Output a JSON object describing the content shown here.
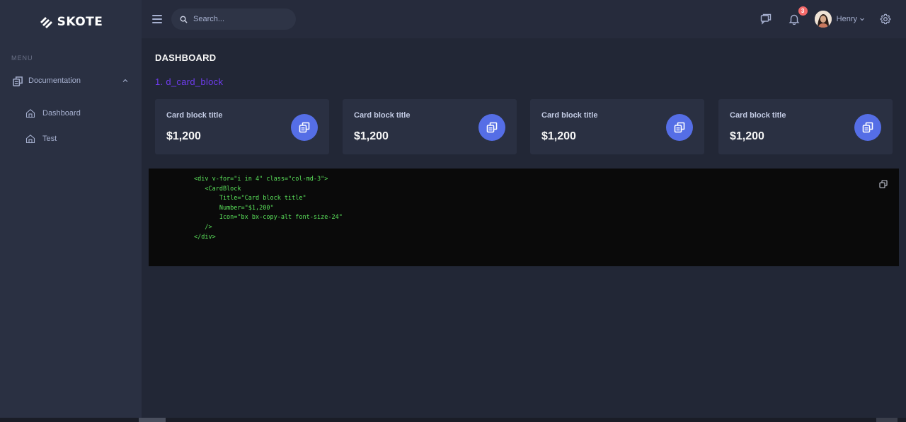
{
  "brand": {
    "name": "SKOTE"
  },
  "search": {
    "placeholder": "Search..."
  },
  "notifications": {
    "count": "3"
  },
  "user": {
    "name": "Henry"
  },
  "sidebar": {
    "menu_title": "MENU",
    "group": {
      "label": "Documentation",
      "expanded": true
    },
    "items": [
      {
        "label": "Dashboard"
      },
      {
        "label": "Test"
      }
    ]
  },
  "main": {
    "page_title": "DASHBOARD",
    "section_title": "1. d_card_block",
    "cards": [
      {
        "title": "Card block title",
        "number": "$1,200"
      },
      {
        "title": "Card block title",
        "number": "$1,200"
      },
      {
        "title": "Card block title",
        "number": "$1,200"
      },
      {
        "title": "Card block title",
        "number": "$1,200"
      }
    ],
    "code": "<div v-for=\"i in 4\" class=\"col-md-3\">\n   <CardBlock\n       Title=\"Card block title\"\n       Number=\"$1,200\"\n       Icon=\"bx bx-copy-alt font-size-24\"\n   />\n</div>"
  },
  "colors": {
    "accent": "#556ee6",
    "section_title": "#6f3cf0",
    "badge": "#f46a6a",
    "code_text": "#5be35b",
    "sidebar_bg": "#2a3042",
    "page_bg": "#222736"
  },
  "icons": {
    "logo": "brand-logo-icon",
    "menu": "hamburger-icon",
    "search": "search-icon",
    "chat": "chat-icon",
    "notification": "bell-icon",
    "settings": "gear-icon",
    "card": "copy-icon",
    "nav": "home-icon"
  }
}
